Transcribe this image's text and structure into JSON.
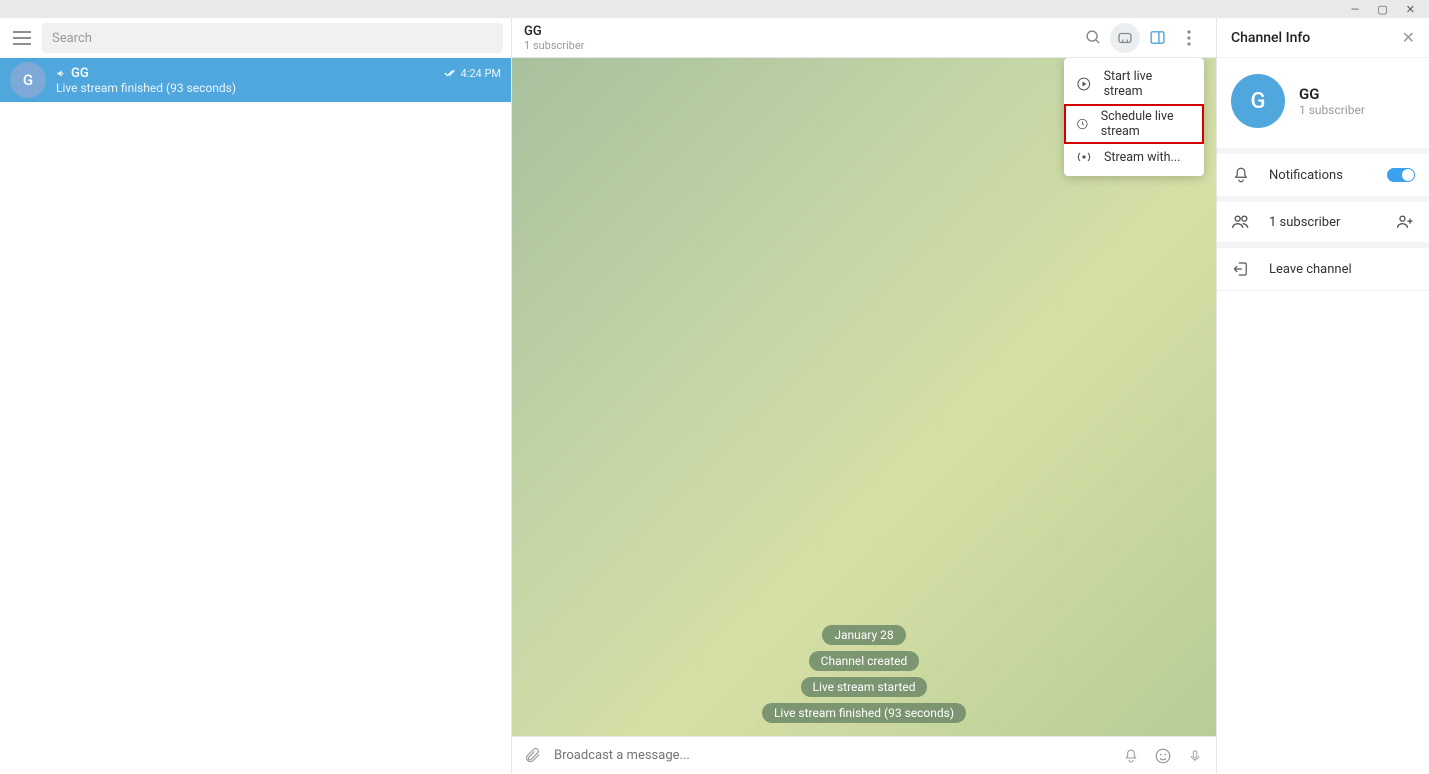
{
  "window_controls": {
    "min": "—",
    "max": "▢",
    "close": "✕"
  },
  "left": {
    "search_placeholder": "Search",
    "chat": {
      "avatar_letter": "G",
      "name": "GG",
      "time": "4:24 PM",
      "subtitle": "Live stream finished (93 seconds)"
    }
  },
  "center": {
    "title": "GG",
    "subtitle": "1 subscriber",
    "dropdown": {
      "start": "Start live stream",
      "schedule": "Schedule live stream",
      "streamwith": "Stream with..."
    },
    "messages": {
      "date": "January 28",
      "created": "Channel created",
      "started": "Live stream started",
      "finished": "Live stream finished (93 seconds)"
    },
    "composer_placeholder": "Broadcast a message..."
  },
  "right": {
    "title": "Channel Info",
    "avatar_letter": "G",
    "name": "GG",
    "sub": "1 subscriber",
    "notifications": "Notifications",
    "subscribers": "1 subscriber",
    "leave": "Leave channel"
  }
}
